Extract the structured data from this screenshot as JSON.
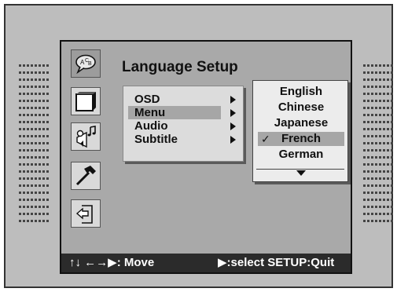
{
  "window": {
    "title": "Language Setup"
  },
  "icons": [
    {
      "name": "language-icon",
      "selected": true
    },
    {
      "name": "tv-display-icon",
      "selected": false
    },
    {
      "name": "audio-speaker-icon",
      "selected": false
    },
    {
      "name": "hammer-icon",
      "selected": false
    },
    {
      "name": "exit-door-icon",
      "selected": false
    }
  ],
  "submenu": {
    "items": [
      {
        "label": "OSD",
        "selected": false
      },
      {
        "label": "Menu",
        "selected": true
      },
      {
        "label": "Audio",
        "selected": false
      },
      {
        "label": "Subtitle",
        "selected": false
      }
    ]
  },
  "options": {
    "items": [
      {
        "label": "English",
        "selected": false
      },
      {
        "label": "Chinese",
        "selected": false
      },
      {
        "label": "Japanese",
        "selected": false
      },
      {
        "label": "French",
        "selected": true
      },
      {
        "label": "German",
        "selected": false
      }
    ],
    "check_mark": "✓"
  },
  "help_bar": {
    "move": "↑↓ ←→▶: Move",
    "select_quit": "▶:select SETUP:Quit"
  },
  "colors": {
    "screen_background": "#bdbdbd",
    "panel_background": "#a9a9a9",
    "highlight": "#a6a6a6",
    "help_bar_background": "#2b2b2b",
    "help_bar_text": "#ffffff"
  }
}
